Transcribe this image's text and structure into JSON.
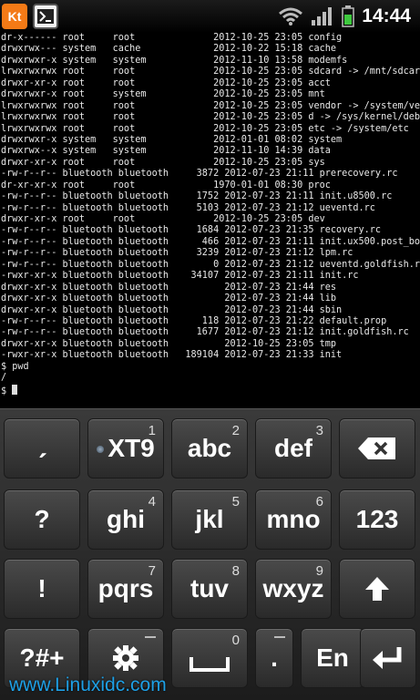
{
  "status_bar": {
    "time": "14:44",
    "app_icon_kt_label": "Kt",
    "icons": [
      "kingsoft-app-icon",
      "terminal-app-icon",
      "wifi-icon",
      "signal-icon",
      "battery-icon"
    ]
  },
  "terminal": {
    "lines": [
      "dr-x------ root     root              2012-10-25 23:05 config",
      "drwxrwx--- system   cache             2012-10-22 15:18 cache",
      "drwxrwxr-x system   system            2012-11-10 13:58 modemfs",
      "lrwxrwxrwx root     root              2012-10-25 23:05 sdcard -> /mnt/sdcard",
      "drwxr-xr-x root     root              2012-10-25 23:05 acct",
      "drwxrwxr-x root     system            2012-10-25 23:05 mnt",
      "lrwxrwxrwx root     root              2012-10-25 23:05 vendor -> /system/vendor",
      "lrwxrwxrwx root     root              2012-10-25 23:05 d -> /sys/kernel/debug",
      "lrwxrwxrwx root     root              2012-10-25 23:05 etc -> /system/etc",
      "drwxrwxr-x system   system            2012-01-01 08:02 system",
      "drwxrwx--x system   system            2012-11-10 14:39 data",
      "drwxr-xr-x root     root              2012-10-25 23:05 sys",
      "-rw-r--r-- bluetooth bluetooth     3872 2012-07-23 21:11 prerecovery.rc",
      "dr-xr-xr-x root     root              1970-01-01 08:30 proc",
      "-rw-r--r-- bluetooth bluetooth     1752 2012-07-23 21:11 init.u8500.rc",
      "-rw-r--r-- bluetooth bluetooth     5103 2012-07-23 21:12 ueventd.rc",
      "drwxr-xr-x root     root              2012-10-25 23:05 dev",
      "-rw-r--r-- bluetooth bluetooth     1684 2012-07-23 21:35 recovery.rc",
      "-rw-r--r-- bluetooth bluetooth      466 2012-07-23 21:11 init.ux500.post_boot.sh",
      "-rw-r--r-- bluetooth bluetooth     3239 2012-07-23 21:12 lpm.rc",
      "-rw-r--r-- bluetooth bluetooth        0 2012-07-23 21:12 ueventd.goldfish.rc",
      "-rwxr-xr-x bluetooth bluetooth    34107 2012-07-23 21:11 init.rc",
      "drwxr-xr-x bluetooth bluetooth          2012-07-23 21:44 res",
      "drwxr-xr-x bluetooth bluetooth          2012-07-23 21:44 lib",
      "drwxr-xr-x bluetooth bluetooth          2012-07-23 21:44 sbin",
      "-rw-r--r-- bluetooth bluetooth      118 2012-07-23 21:22 default.prop",
      "-rw-r--r-- bluetooth bluetooth     1677 2012-07-23 21:12 init.goldfish.rc",
      "drwxr-xr-x bluetooth bluetooth          2012-10-25 23:05 tmp",
      "-rwxr-xr-x bluetooth bluetooth   189104 2012-07-23 21:33 init",
      "$ pwd",
      "/",
      "$ "
    ]
  },
  "keyboard": {
    "row1": [
      {
        "main": "ˏ",
        "num": "",
        "name": "key-comma"
      },
      {
        "main": "XT9",
        "num": "1",
        "name": "key-xt9"
      },
      {
        "main": "abc",
        "num": "2",
        "name": "key-abc"
      },
      {
        "main": "def",
        "num": "3",
        "name": "key-def"
      },
      {
        "main": "",
        "num": "",
        "name": "key-backspace"
      }
    ],
    "row2": [
      {
        "main": "?",
        "num": "",
        "name": "key-question"
      },
      {
        "main": "ghi",
        "num": "4",
        "name": "key-ghi"
      },
      {
        "main": "jkl",
        "num": "5",
        "name": "key-jkl"
      },
      {
        "main": "mno",
        "num": "6",
        "name": "key-mno"
      },
      {
        "main": "123",
        "num": "",
        "name": "key-123"
      }
    ],
    "row3": [
      {
        "main": "!",
        "num": "",
        "name": "key-exclamation"
      },
      {
        "main": "pqrs",
        "num": "7",
        "name": "key-pqrs"
      },
      {
        "main": "tuv",
        "num": "8",
        "name": "key-tuv"
      },
      {
        "main": "wxyz",
        "num": "9",
        "name": "key-wxyz"
      },
      {
        "main": "",
        "num": "",
        "name": "key-shift"
      }
    ],
    "row4": [
      {
        "main": "?#+",
        "num": "",
        "name": "key-symbols"
      },
      {
        "main": "",
        "num": "",
        "name": "key-settings"
      },
      {
        "main": "",
        "num": "0",
        "name": "key-space"
      },
      {
        "main": ".",
        "num": "",
        "name": "key-period"
      },
      {
        "main": "En",
        "num": "",
        "name": "key-language"
      },
      {
        "main": "",
        "num": "",
        "name": "key-enter"
      }
    ]
  },
  "watermark": "www.Linuxidc.com"
}
